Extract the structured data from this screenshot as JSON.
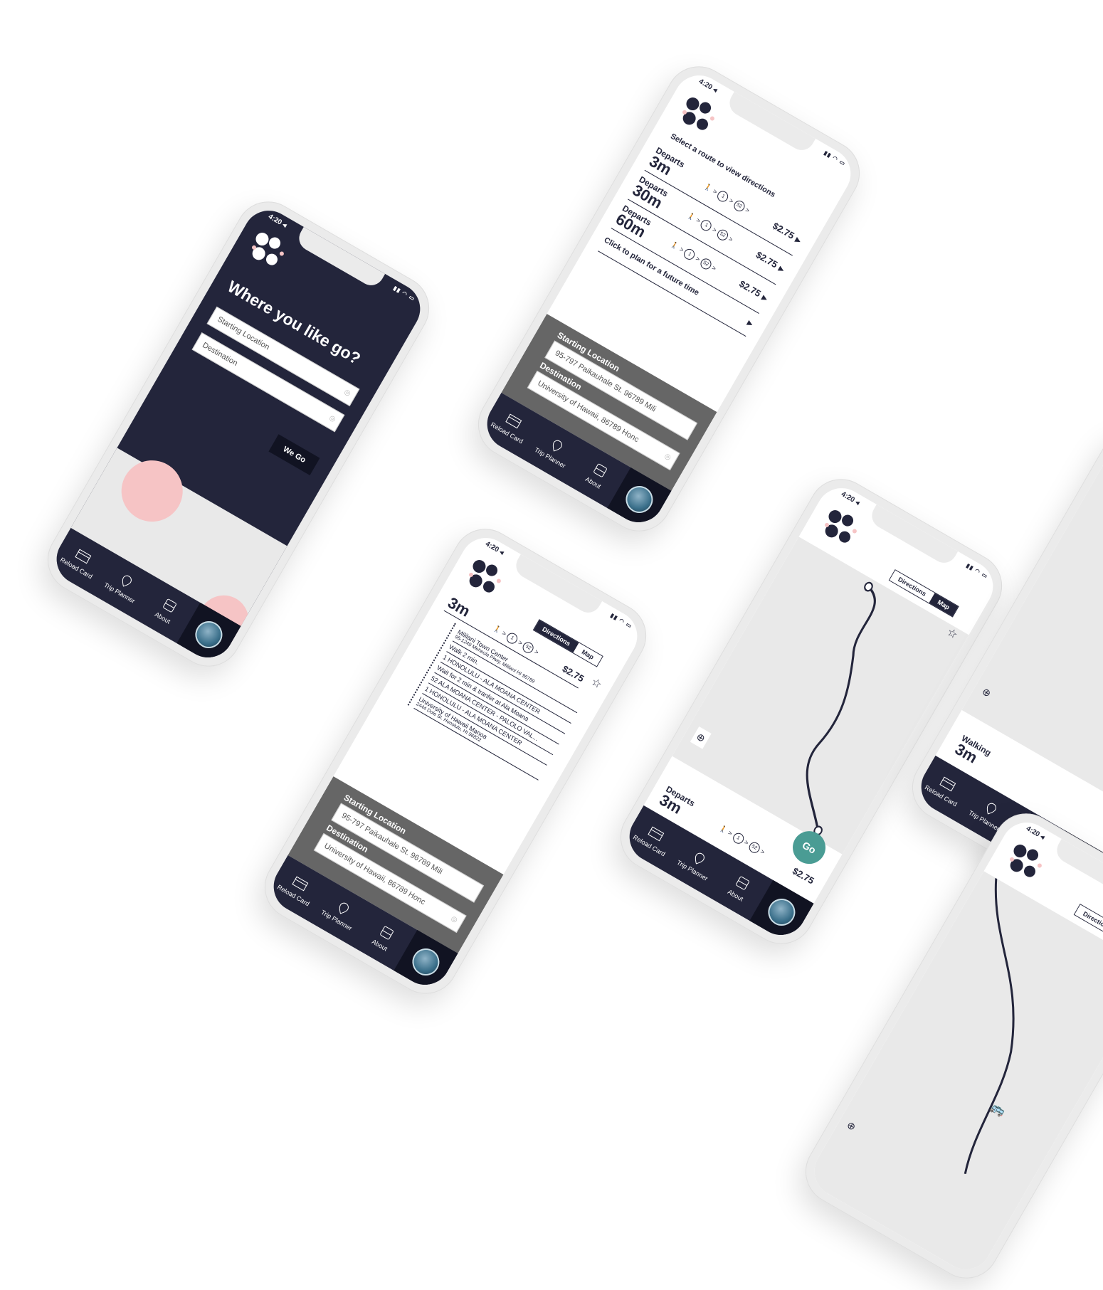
{
  "status": {
    "time": "4:20 ◂"
  },
  "nav": {
    "reload": "Reload Card",
    "planner": "Trip Planner",
    "about": "About"
  },
  "toggle": {
    "directions": "Directions",
    "map": "Map"
  },
  "home": {
    "headline": "Where you like go?",
    "start_placeholder": "Starting Location",
    "dest_placeholder": "Destination",
    "go": "We Go"
  },
  "routes": {
    "heading": "Select a route to view directions",
    "items": [
      {
        "label": "Departs",
        "time": "3m",
        "price": "$2.75"
      },
      {
        "label": "Departs",
        "time": "30m",
        "price": "$2.75"
      },
      {
        "label": "Departs",
        "time": "60m",
        "price": "$2.75"
      }
    ],
    "future": "Click to plan for a future time"
  },
  "trip": {
    "start_label": "Starting Location",
    "start_value": "95-797 Paikauhale St. 96789 Mili",
    "dest_label": "Destination",
    "dest_value": "University of Hawaii, 86789 Honc"
  },
  "directions": {
    "time": "3m",
    "price": "$2.75",
    "steps": [
      {
        "title": "Mililani Town Center",
        "sub": "95-1249 Meheula Pkwy, Mililani HI 96789"
      },
      {
        "title": "Walk 2 min.",
        "sub": ""
      },
      {
        "title": "1 HONOLULU - ALA MOANA CENTER",
        "sub": ""
      },
      {
        "title": "Wait for 2 min & tranfer at Ala Moana",
        "sub": ""
      },
      {
        "title": "52 ALA MOANA CENTER - PALOLO VAL...",
        "sub": ""
      },
      {
        "title": "1 HONOLULU - ALA MOANA CENTER",
        "sub": ""
      },
      {
        "title": "University of Hawaii Manoa",
        "sub": "2444 Dole St. Honolulu, HI 96822"
      }
    ]
  },
  "mapview": {
    "label": "Departs",
    "time": "3m",
    "price": "$2.75",
    "go": "Go"
  },
  "walking": {
    "label": "Walking",
    "time": "3m"
  },
  "route_icons": {
    "bus1": "1",
    "bus2": "52"
  },
  "colors": {
    "navy": "#23253b",
    "pink": "#f6c4c5",
    "teal": "#4a9c94",
    "gray": "#666666"
  }
}
